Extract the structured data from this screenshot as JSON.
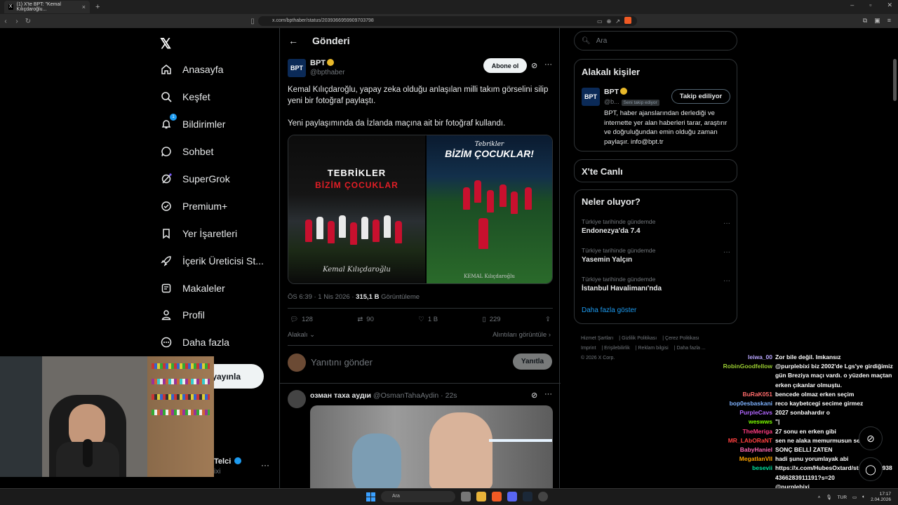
{
  "browser": {
    "tab_title": "(1) X'te BPT: \"Kemal Kılıçdaroğlu...",
    "url": "x.com/bpthaber/status/2039366959909703798"
  },
  "nav": {
    "items": [
      {
        "label": "Anasayfa",
        "icon": "home-icon"
      },
      {
        "label": "Keşfet",
        "icon": "search-icon"
      },
      {
        "label": "Bildirimler",
        "icon": "bell-icon",
        "badge": "1"
      },
      {
        "label": "Sohbet",
        "icon": "chat-icon"
      },
      {
        "label": "SuperGrok",
        "icon": "grok-icon"
      },
      {
        "label": "Premium+",
        "icon": "premium-icon"
      },
      {
        "label": "Yer İşaretleri",
        "icon": "bookmark-icon"
      },
      {
        "label": "İçerik Üreticisi St...",
        "icon": "rocket-icon"
      },
      {
        "label": "Makaleler",
        "icon": "article-icon"
      },
      {
        "label": "Profil",
        "icon": "person-icon"
      },
      {
        "label": "Daha fazla",
        "icon": "more-circle-icon"
      }
    ],
    "post_button": "Gönderi yayınla",
    "account_name": "Telci",
    "account_handle": "ixi"
  },
  "tweet": {
    "header": "Gönderi",
    "author": "BPT",
    "handle": "@bpthaber",
    "subscribe": "Abone ol",
    "text_1": "Kemal Kılıçdaroğlu, yapay zeka olduğu anlaşılan milli takım görselini silip yeni bir fotoğraf paylaştı.",
    "text_2": "Yeni paylaşımında da İzlanda maçına ait bir fotoğraf kullandı.",
    "image1_title": "TEBRİKLER",
    "image1_subtitle": "BİZİM ÇOCUKLAR",
    "image1_signature": "Kemal Kılıçdaroğlu",
    "image2_script": "Tebrikler",
    "image2_title": "BİZİM ÇOCUKLAR!",
    "image2_signature": "KEMAL Kılıçdaroğlu",
    "time": "ÖS 6:39 · 1 Nis 2026 ·",
    "views": "315,1 B",
    "views_label": "Görüntüleme",
    "replies": "128",
    "reposts": "90",
    "likes": "1 B",
    "bookmarks": "229",
    "related": "Alakalı",
    "quotes": "Alıntıları görüntüle",
    "reply_placeholder": "Yanıtını gönder",
    "reply_button": "Yanıtla"
  },
  "reply": {
    "name": "озман таха аудıи",
    "handle": "@OsmanTahaAydin · 22s"
  },
  "right": {
    "search_placeholder": "Ara",
    "relevant_title": "Alakalı kişiler",
    "rp_name": "BPT",
    "rp_handle": "@b...",
    "rp_chip": "Seni takip ediyor",
    "rp_follow": "Takip ediliyor",
    "rp_bio": "BPT, haber ajanslarından derlediği ve internette yer alan haberleri tarar, araştırır ve doğruluğundan emin olduğu zaman paylaşır. info@bpt.tr",
    "live_title": "X'te Canlı",
    "trends_title": "Neler oluyor?",
    "trends": [
      {
        "context": "Türkiye tarihinde gündemde",
        "name": "Endonezya'da 7.4"
      },
      {
        "context": "Türkiye tarihinde gündemde",
        "name": "Yasemin Yalçın"
      },
      {
        "context": "Türkiye tarihinde gündemde",
        "name": "İstanbul Havalimanı'nda"
      }
    ],
    "show_more": "Daha fazla göster",
    "footer": [
      "Hizmet Şartları",
      "Gizlilik Politikası",
      "Çerez Politikası",
      "Imprint",
      "Erişilebilirlik",
      "Reklam bilgisi",
      "Daha fazla ...",
      "© 2026 X Corp."
    ]
  },
  "chat": [
    {
      "user": "leiwa_00",
      "color": "#b9a6ff",
      "msg": "Zor bile değil. Imkansız"
    },
    {
      "user": "RobinGoodfellow",
      "color": "#9acd32",
      "msg": "@purplebixi biz 2002'de Lgs'ye girdiğimiz gün Breziya maçı vardı. o yüzden maçtan erken çıkanlar olmuştu."
    },
    {
      "user": "BuRaK051",
      "color": "#ff6b6b",
      "msg": "bencede olmaz erken seçim"
    },
    {
      "user": "bop0esbaskani",
      "color": "#7fb3ff",
      "msg": "reco kaybetcegi secime girmez"
    },
    {
      "user": "PurpleCavs",
      "color": "#b266ff",
      "msg": "2027 sonbahardır o"
    },
    {
      "user": "weswws",
      "color": "#7cfc00",
      "msg": "\"|"
    },
    {
      "user": "TheMeriga",
      "color": "#ff3b7f",
      "msg": "27 sonu en erken gibi"
    },
    {
      "user": "MR_LAbORaNT",
      "color": "#ff4040",
      "msg": "sen ne alaka memurmusun sen amk"
    },
    {
      "user": "BabyHaniel",
      "color": "#ff69b4",
      "msg": "SONÇ BELLİ ZATEN"
    },
    {
      "user": "MegatlanVII",
      "color": "#ffa500",
      "msg": "hadi şunu yorumlayak abi"
    },
    {
      "user": "besevii",
      "color": "#00e5a0",
      "msg": "https://x.com/HubesOxtard/status/2039384366283911191?s=20"
    },
    {
      "user": "",
      "color": "#ffffff",
      "msg": "@purplebixi"
    }
  ],
  "taskbar": {
    "search": "Ara",
    "lang": "TUR",
    "time": "17:17",
    "date": "2.04.2026"
  }
}
